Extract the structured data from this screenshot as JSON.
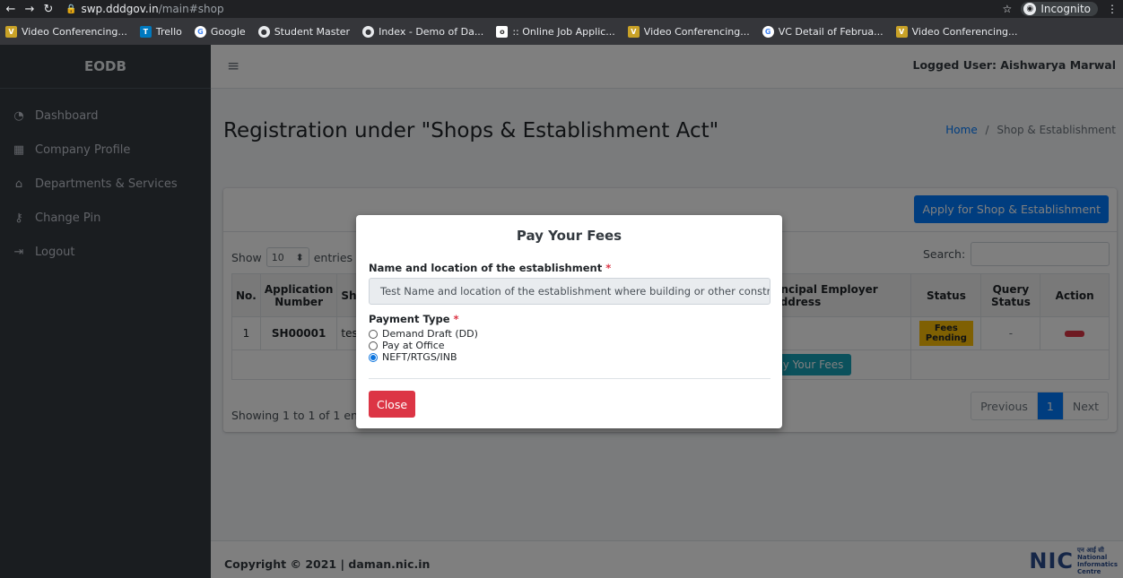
{
  "browser": {
    "url_host": "swp.dddgov.in",
    "url_path": "/main#shop",
    "incognito_label": "Incognito",
    "bookmarks": [
      {
        "label": "Video Conferencing...",
        "icon": "vc-icon",
        "color": "#c9a227"
      },
      {
        "label": "Trello",
        "icon": "trello-icon",
        "color": "#0079bf"
      },
      {
        "label": "Google",
        "icon": "google-icon",
        "color": "#ffffff"
      },
      {
        "label": "Student Master",
        "icon": "globe-icon",
        "color": "#ffffff"
      },
      {
        "label": "Index - Demo of Da...",
        "icon": "globe-icon",
        "color": "#ffffff"
      },
      {
        "label": ":: Online Job Applic...",
        "icon": "job-icon",
        "color": "#ffffff"
      },
      {
        "label": "Video Conferencing...",
        "icon": "vc-icon",
        "color": "#c9a227"
      },
      {
        "label": "VC Detail of Februa...",
        "icon": "google-icon",
        "color": "#ffffff"
      },
      {
        "label": "Video Conferencing...",
        "icon": "vc-icon",
        "color": "#c9a227"
      }
    ]
  },
  "sidebar": {
    "brand": "EODB",
    "items": [
      {
        "label": "Dashboard",
        "icon": "dashboard-icon"
      },
      {
        "label": "Company Profile",
        "icon": "building-icon"
      },
      {
        "label": "Departments & Services",
        "icon": "bank-icon"
      },
      {
        "label": "Change Pin",
        "icon": "key-icon"
      },
      {
        "label": "Logout",
        "icon": "logout-icon"
      }
    ]
  },
  "header": {
    "logged_user": "Logged User: Aishwarya Marwal"
  },
  "page": {
    "title": "Registration under \"Shops & Establishment Act\"",
    "breadcrumb_home": "Home",
    "breadcrumb_sep": "/",
    "breadcrumb_current": "Shop & Establishment"
  },
  "card": {
    "apply_button": "Apply for Shop & Establishment",
    "show_label": "Show",
    "entries_value": "10",
    "entries_label": "entries",
    "search_label": "Search:",
    "columns": [
      "No.",
      "Application Number",
      "Sh",
      "rincipal Employer Address",
      "Status",
      "Query Status",
      "Action"
    ],
    "rows": [
      {
        "no": "1",
        "app_no": "SH00001",
        "shop": "test",
        "address": "",
        "status": "Fees Pending",
        "query_status": "-"
      }
    ],
    "pay_fees_button": "ay Your Fees",
    "showing_text": "Showing 1 to 1 of 1 entri",
    "pager": {
      "prev": "Previous",
      "page": "1",
      "next": "Next"
    }
  },
  "footer": {
    "copyright_prefix": "Copyright © 2021 | ",
    "copyright_site": "daman.nic.in",
    "nic_mark": "NIC",
    "nic_lines": [
      "एन आई सी",
      "National",
      "Informatics",
      "Centre"
    ]
  },
  "modal": {
    "title": "Pay Your Fees",
    "field_label": "Name and location of the establishment",
    "required_mark": "*",
    "field_value": "Test Name and location of the establishment where building or other construct",
    "payment_label": "Payment Type",
    "options": [
      {
        "label": "Demand Draft (DD)",
        "selected": false
      },
      {
        "label": "Pay at Office",
        "selected": false
      },
      {
        "label": "NEFT/RTGS/INB",
        "selected": true
      }
    ],
    "close_button": "Close"
  },
  "colors": {
    "sidebar_bg": "#343a40",
    "primary": "#007bff",
    "danger": "#dc3545",
    "warning": "#ffc107",
    "info": "#17a2b8"
  }
}
